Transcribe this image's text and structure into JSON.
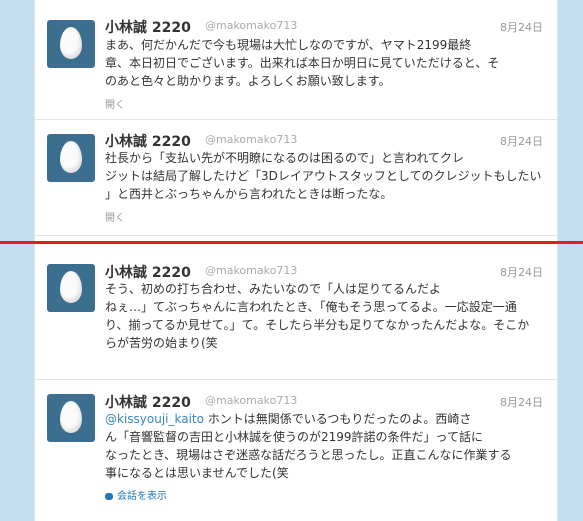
{
  "tweets": [
    {
      "name": "小林誠 2220",
      "handle": "@makomako713",
      "date": "8月24日",
      "lines": [
        "まあ、何だかんだで今も現場は大忙しなのですが、ヤマト2199最終",
        "章、本日初日でございます。出来れば本日か明日に見ていただけると、そ",
        "のあと色々と助かります。よろしくお願い致します。"
      ],
      "action": "開く"
    },
    {
      "name": "小林誠 2220",
      "handle": "@makomako713",
      "date": "8月24日",
      "lines": [
        "社長から「支払い先が不明瞭になるのは困るので」と言われてクレ",
        "ジットは結局了解したけど「3Dレイアウトスタッフとしてのクレジットもしたい",
        "」と西井とぶっちゃんから言われたときは断ったな。"
      ],
      "action": "開く"
    },
    {
      "name": "小林誠 2220",
      "handle": "@makomako713",
      "date": "8月24日",
      "lines": [
        "そう、初めの打ち合わせ、みたいなので「人は足りてるんだよ",
        "ねぇ…」てぶっちゃんに言われたとき、「俺もそう思ってるよ。一応設定一通",
        "り、揃ってるか見せて。」て。そしたら半分も足りてなかったんだよな。そこか",
        "らが苦労の始まり(笑"
      ],
      "action": ""
    },
    {
      "name": "小林誠 2220",
      "handle": "@makomako713",
      "date": "8月24日",
      "mention": "@kissyouji_kaito",
      "lines": [
        " ホントは無関係でいるつもりだったのよ。西崎さ",
        "ん「音響監督の吉田と小林誠を使うのが2199許諾の条件だ」って話に",
        "なったとき、現場はさぞ迷惑な話だろうと思ったし。正直こんなに作業する",
        "事になるとは思いませんでした(笑"
      ],
      "action": "会話を表示"
    }
  ]
}
